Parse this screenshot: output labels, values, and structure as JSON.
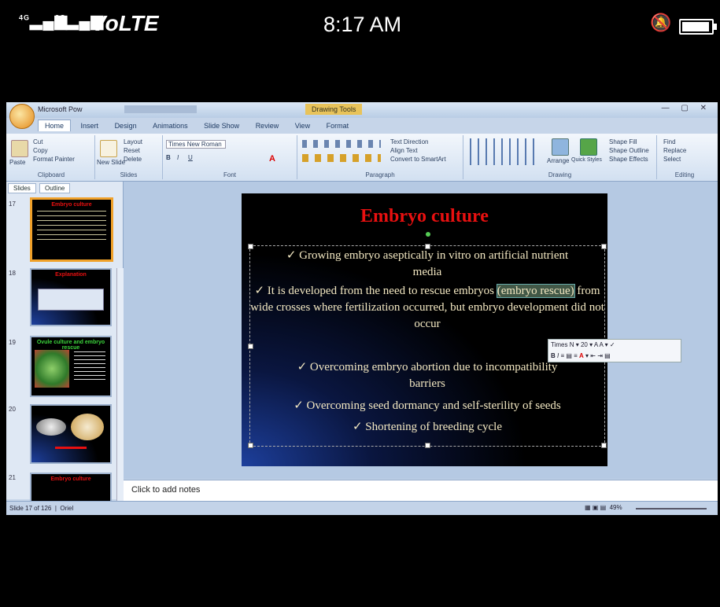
{
  "phone_status": {
    "signal_1": "4G",
    "signal_2": "3G",
    "network": "VoLTE",
    "time": "8:17 AM"
  },
  "window": {
    "title": "Microsoft Pow",
    "context_tab": "Drawing Tools"
  },
  "ribbon": {
    "tabs": [
      "Home",
      "Insert",
      "Design",
      "Animations",
      "Slide Show",
      "Review",
      "View",
      "Format"
    ],
    "groups": {
      "clipboard": {
        "label": "Clipboard",
        "paste": "Paste",
        "cut": "Cut",
        "copy": "Copy",
        "format_painter": "Format Painter"
      },
      "slides": {
        "label": "Slides",
        "new_slide": "New Slide",
        "layout": "Layout",
        "reset": "Reset",
        "delete": "Delete"
      },
      "font": {
        "label": "Font",
        "font_name": "Times New Roman",
        "bold": "B",
        "italic": "I",
        "underline": "U"
      },
      "paragraph": {
        "label": "Paragraph",
        "text_direction": "Text Direction",
        "align_text": "Align Text",
        "convert_smartart": "Convert to SmartArt"
      },
      "drawing": {
        "label": "Drawing",
        "arrange": "Arrange",
        "quick_styles": "Quick Styles",
        "shape_fill": "Shape Fill",
        "shape_outline": "Shape Outline",
        "shape_effects": "Shape Effects"
      },
      "editing": {
        "label": "Editing",
        "find": "Find",
        "replace": "Replace",
        "select": "Select"
      }
    }
  },
  "slides_pane": {
    "tabs": [
      "Slides",
      "Outline"
    ],
    "thumbnails": [
      {
        "number": "17",
        "title": "Embryo culture",
        "title_color": "#e81010"
      },
      {
        "number": "18",
        "title": "Explanation",
        "title_color": "#e81010"
      },
      {
        "number": "19",
        "title": "Ovule culture and embryo rescue",
        "title_color": "#3cd43c"
      },
      {
        "number": "20",
        "title": "",
        "title_color": "#e81010"
      },
      {
        "number": "21",
        "title": "Embryo culture",
        "title_color": "#e81010"
      }
    ]
  },
  "slide": {
    "title": "Embryo culture",
    "bullets": [
      {
        "text": "✓ Growing embryo aseptically in vitro on artificial nutrient",
        "cont": "media"
      },
      {
        "pre": "✓ It is developed from the need to rescue embryos ",
        "highlight": "(embryo rescue)",
        "post": " from wide crosses where fertilization occurred, but embryo development did not occur"
      },
      {
        "text": "✓ Overcoming embryo abortion due to incompatibility",
        "cont": "barriers"
      },
      {
        "text": "✓ Overcoming seed dormancy and self-sterility of seeds"
      },
      {
        "text": "✓ Shortening of breeding cycle"
      }
    ],
    "title_color": "#e81010",
    "text_color": "#f3e8c2"
  },
  "mini_toolbar": {
    "font": "Times N",
    "size": "20"
  },
  "notes": {
    "placeholder": "Click to add notes"
  },
  "status": {
    "slide_info": "Slide 17 of 126",
    "theme": "Oriel",
    "zoom": "49%"
  }
}
